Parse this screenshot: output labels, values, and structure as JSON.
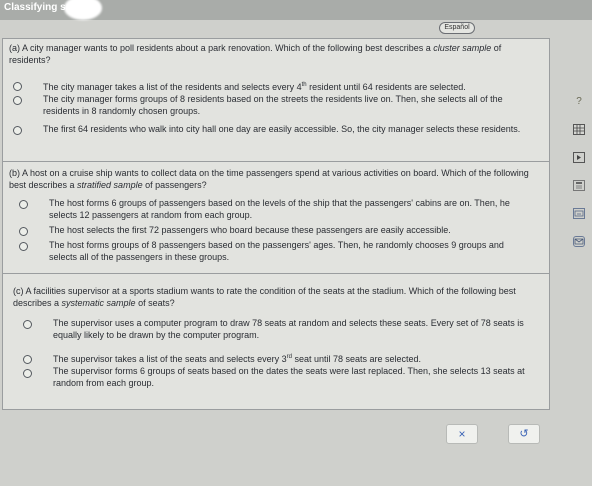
{
  "window": {
    "title": "Classifying sa"
  },
  "header": {
    "language_button": "Español"
  },
  "parts": {
    "a": {
      "question_prefix": "(a) A city manager wants to poll residents about a park renovation. Which of the following best describes a ",
      "question_term": "cluster sample",
      "question_suffix": " of residents?",
      "options": [
        {
          "pre": "The city manager takes a list of the residents and selects every 4",
          "sup": "th",
          "post": " resident until 64 residents are selected."
        },
        {
          "pre": "The city manager forms groups of 8 residents based on the streets the residents live on. Then, she selects all of the residents in 8 randomly chosen groups.",
          "sup": "",
          "post": ""
        },
        {
          "pre": "The first 64 residents who walk into city hall one day are easily accessible. So, the city manager selects these residents.",
          "sup": "",
          "post": ""
        }
      ]
    },
    "b": {
      "question_prefix": "(b) A host on a cruise ship wants to collect data on the time passengers spend at various activities on board. Which of the following best describes a ",
      "question_term": "stratified sample",
      "question_suffix": " of passengers?",
      "options": [
        {
          "pre": "The host forms 6 groups of passengers based on the levels of the ship that the passengers' cabins are on. Then, he selects 12 passengers at random from each group.",
          "sup": "",
          "post": ""
        },
        {
          "pre": "The host selects the first 72 passengers who board because these passengers are easily accessible.",
          "sup": "",
          "post": ""
        },
        {
          "pre": "The host forms groups of 8 passengers based on the passengers' ages. Then, he randomly chooses 9 groups and selects all of the passengers in these groups.",
          "sup": "",
          "post": ""
        }
      ]
    },
    "c": {
      "question_prefix": "(c) A facilities supervisor at a sports stadium wants to rate the condition of the seats at the stadium. Which of the following best describes a ",
      "question_term": "systematic sample",
      "question_suffix": " of seats?",
      "options": [
        {
          "pre": "The supervisor uses a computer program to draw 78 seats at random and selects these seats. Every set of 78 seats is equally likely to be drawn by the computer program.",
          "sup": "",
          "post": ""
        },
        {
          "pre": "The supervisor takes a list of the seats and selects every 3",
          "sup": "rd",
          "post": " seat until 78 seats are selected."
        },
        {
          "pre": "The supervisor forms 6 groups of seats based on the dates the seats were last replaced. Then, she selects 13 seats at random from each group.",
          "sup": "",
          "post": ""
        }
      ]
    }
  },
  "sidebar": {
    "help_icon": "?",
    "icons": [
      "table-icon",
      "video-icon",
      "calculator-icon",
      "keyboard-icon",
      "mail-icon"
    ]
  },
  "footer": {
    "close_label": "×",
    "reset_label": "↺"
  },
  "colors": {
    "accent": "#3a63b5",
    "panel_bg": "#e2e3df",
    "page_bg": "#cfd0cc"
  }
}
